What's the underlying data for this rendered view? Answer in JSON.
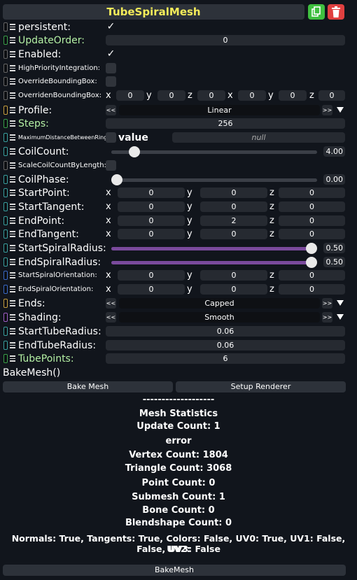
{
  "title": "TubeSpiralMesh",
  "icons": {
    "copy": "copy-icon",
    "delete": "trash-icon"
  },
  "colors": {
    "accent_yellow": "#f4ec5a",
    "label_green": "#b4f0a4",
    "copy_btn": "#3fbf3f",
    "delete_btn": "#e04040",
    "slider_fill": "#7a4a9c"
  },
  "props": {
    "persistent": {
      "label": "persistent:",
      "checked": true
    },
    "updateOrder": {
      "label": "UpdateOrder:",
      "value": "0"
    },
    "enabled": {
      "label": "Enabled:",
      "checked": true
    },
    "highPriority": {
      "label": "HighPriorityIntegration:",
      "checked": false
    },
    "overrideBB": {
      "label": "OverrideBoundingBox:",
      "checked": false
    },
    "overridenBB": {
      "label": "OverridenBoundingBox:",
      "axes": [
        "x",
        "y",
        "z",
        "x",
        "y",
        "z"
      ],
      "values": [
        "0",
        "0",
        "0",
        "0",
        "0",
        "0"
      ]
    },
    "profile": {
      "label": "Profile:",
      "value": "Linear",
      "prev": "<<",
      "next": ">>"
    },
    "steps": {
      "label": "Steps:",
      "value": "256"
    },
    "maxDist": {
      "label": "MaximumDistanceBetweenRings:",
      "toggle_label": "value",
      "value": "null"
    },
    "coilCount": {
      "label": "CoilCount:",
      "value": "4.00",
      "fraction": 0.09
    },
    "scaleCoil": {
      "label": "ScaleCoilCountByLength:",
      "checked": false
    },
    "coilPhase": {
      "label": "CoilPhase:",
      "value": "0.00",
      "fraction": 0.0
    },
    "startPoint": {
      "label": "StartPoint:",
      "axes": [
        "x",
        "y",
        "z"
      ],
      "values": [
        "0",
        "0",
        "0"
      ]
    },
    "startTangent": {
      "label": "StartTangent:",
      "axes": [
        "x",
        "y",
        "z"
      ],
      "values": [
        "0",
        "0",
        "0"
      ]
    },
    "endPoint": {
      "label": "EndPoint:",
      "axes": [
        "x",
        "y",
        "z"
      ],
      "values": [
        "0",
        "2",
        "0"
      ]
    },
    "endTangent": {
      "label": "EndTangent:",
      "axes": [
        "x",
        "y",
        "z"
      ],
      "values": [
        "0",
        "0",
        "0"
      ]
    },
    "startSpiralRadius": {
      "label": "StartSpiralRadius:",
      "value": "0.50",
      "fraction": 1.0
    },
    "endSpiralRadius": {
      "label": "EndSpiralRadius:",
      "value": "0.50",
      "fraction": 1.0
    },
    "startSpiralOrient": {
      "label": "StartSpiralOrientation:",
      "axes": [
        "x",
        "y",
        "z"
      ],
      "values": [
        "0",
        "0",
        "0"
      ]
    },
    "endSpiralOrient": {
      "label": "EndSpiralOrientation:",
      "axes": [
        "x",
        "y",
        "z"
      ],
      "values": [
        "0",
        "0",
        "0"
      ]
    },
    "ends": {
      "label": "Ends:",
      "value": "Capped",
      "prev": "<<",
      "next": ">>"
    },
    "shading": {
      "label": "Shading:",
      "value": "Smooth",
      "prev": "<<",
      "next": ">>"
    },
    "startTubeRadius": {
      "label": "StartTubeRadius:",
      "value": "0.06"
    },
    "endTubeRadius": {
      "label": "EndTubeRadius:",
      "value": "0.06"
    },
    "tubePoints": {
      "label": "TubePoints:",
      "value": "6"
    }
  },
  "bake": {
    "header": "BakeMesh()",
    "bake_button": "Bake Mesh",
    "setup_button": "Setup Renderer",
    "bottom_button": "BakeMesh"
  },
  "stats": {
    "divider": "-------------------",
    "title": "Mesh Statistics",
    "update_count": "Update Count: 1",
    "error": "error",
    "vertex_count": "Vertex Count: 1804",
    "triangle_count": "Triangle Count: 3068",
    "point_count": "Point Count: 0",
    "submesh_count": "Submesh Count: 1",
    "bone_count": "Bone Count: 0",
    "blendshape_count": "Blendshape Count: 0",
    "channels_line1": "Normals: True, Tangents: True, Colors: False, UV0: True, UV1: False, UV2:",
    "channels_line2": "False, UV3: False"
  }
}
